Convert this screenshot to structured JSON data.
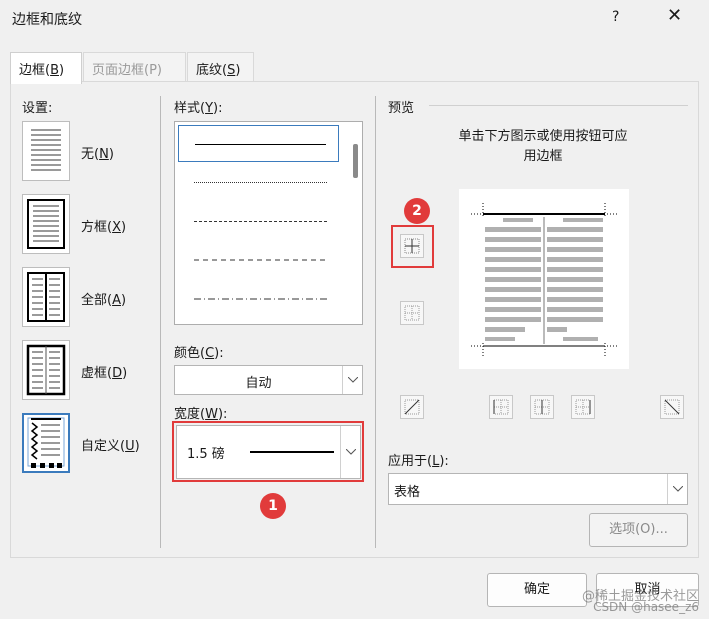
{
  "window": {
    "title": "边框和底纹",
    "help": "?",
    "close": "✕"
  },
  "tabs": [
    {
      "label": "边框(",
      "key": "B",
      "suffix": ")"
    },
    {
      "label": "页面边框(P)"
    },
    {
      "label": "底纹(",
      "key": "S",
      "suffix": ")"
    }
  ],
  "settings": {
    "label": "设置:",
    "items": [
      {
        "label": "无(",
        "key": "N",
        "suffix": ")"
      },
      {
        "label": "方框(",
        "key": "X",
        "suffix": ")"
      },
      {
        "label": "全部(",
        "key": "A",
        "suffix": ")"
      },
      {
        "label": "虚框(",
        "key": "D",
        "suffix": ")"
      },
      {
        "label": "自定义(",
        "key": "U",
        "suffix": ")"
      }
    ]
  },
  "style": {
    "label": "样式(",
    "key": "Y",
    "suffix": "):"
  },
  "color": {
    "label": "颜色(",
    "key": "C",
    "suffix": "):",
    "value": "自动"
  },
  "width": {
    "label": "宽度(",
    "key": "W",
    "suffix": "):",
    "value": "1.5 磅"
  },
  "preview": {
    "label": "预览",
    "hint_line1": "单击下方图示或使用按钮可应",
    "hint_line2": "用边框"
  },
  "apply_to": {
    "label": "应用于(",
    "key": "L",
    "suffix": "):",
    "value": "表格"
  },
  "buttons": {
    "options": "选项(O)...",
    "ok": "确定",
    "cancel": "取消"
  },
  "annotations": {
    "badge1": "1",
    "badge2": "2",
    "accent": "#e13b3b"
  },
  "watermark": {
    "line1": "@稀土掘金技术社区",
    "line2": "CSDN @hasee_z6"
  }
}
